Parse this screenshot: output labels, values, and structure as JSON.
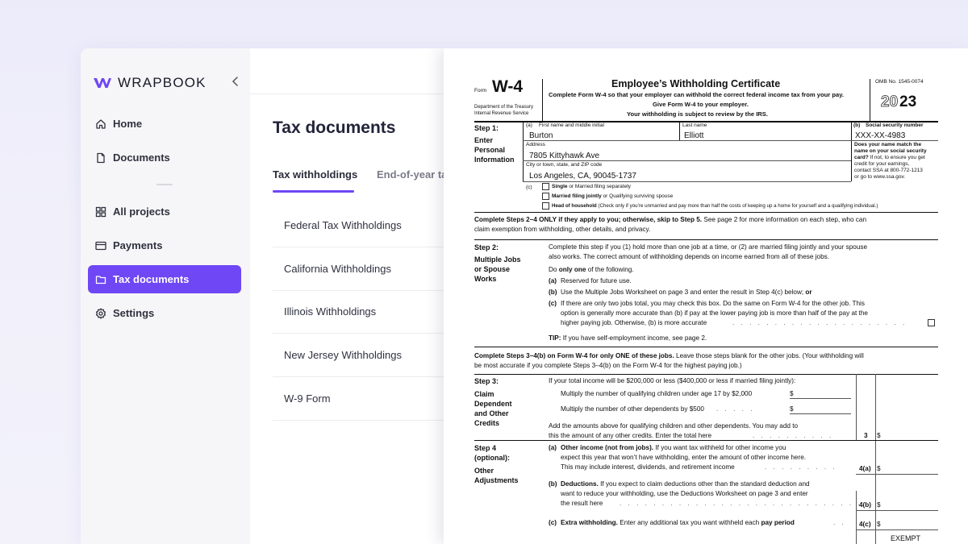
{
  "brand": {
    "name": "WRAPBOOK"
  },
  "colors": {
    "accent": "#6f47f5",
    "sidebar_bg": "#f6f6f8"
  },
  "sidebar": {
    "items": [
      {
        "label": "Home",
        "icon": "home-icon"
      },
      {
        "label": "Documents",
        "icon": "document-icon"
      },
      {
        "label": "All projects",
        "icon": "grid-icon"
      },
      {
        "label": "Payments",
        "icon": "card-icon"
      },
      {
        "label": "Tax documents",
        "icon": "folder-icon",
        "active": true
      },
      {
        "label": "Settings",
        "icon": "gear-icon"
      }
    ]
  },
  "main": {
    "title": "Tax documents",
    "tabs": [
      {
        "label": "Tax withholdings",
        "active": true
      },
      {
        "label": "End-of-year ta"
      }
    ],
    "list": [
      "Federal Tax Withholdings",
      "California Withholdings",
      "Illinois Withholdings",
      "New Jersey Withholdings",
      "W-9 Form"
    ]
  },
  "form": {
    "form_label": "Form",
    "form_name": "W-4",
    "dept": "Department of the Treasury",
    "irs": "Internal Revenue Service",
    "title": "Employee’s Withholding Certificate",
    "sub1": "Complete Form W-4 so that your employer can withhold the correct federal income tax from your pay.",
    "sub2": "Give Form W-4 to your employer.",
    "sub3": "Your withholding is subject to review by the IRS.",
    "omb": "OMB No. 1545-0074",
    "year_outline": "20",
    "year_bold": "23",
    "step1": {
      "label": "Step 1:",
      "l2": "Enter",
      "l3": "Personal",
      "l4": "Information"
    },
    "fields": {
      "a_label": "(a)",
      "first_label": "First name and middle initial",
      "first_value": "Burton",
      "last_label": "Last name",
      "last_value": "Elliott",
      "b_label": "(b)",
      "ssn_label": "Social security number",
      "ssn_value": "XXX-XX-4983",
      "address_label": "Address",
      "address_value": "7805 Kittyhawk Ave",
      "city_label": "City or town, state, and ZIP code",
      "city_value": "Los Angeles, CA, 90045-1737",
      "name_match": "Does your name match the",
      "name_match2": "name on your social security",
      "name_match3": "card?",
      "name_match3b": " If not, to ensure you get",
      "name_match4": "credit for your earnings,",
      "name_match5": "contact SSA at 800-772-1213",
      "name_match6": "or go to www.ssa.gov.",
      "c_label": "(c)",
      "single_b": "Single",
      "single_rest": " or Married filing separately",
      "married_b": "Married filing jointly",
      "married_rest": " or Qualifying surviving spouse",
      "hoh_b": "Head of household",
      "hoh_rest": " (Check only if you’re unmarried and pay more than half the costs of keeping up a home for yourself and a qualifying individual.)"
    },
    "notice_b": "Complete Steps 2–4 ONLY if they apply to you; otherwise, skip to Step 5.",
    "notice_rest": " See page 2 for more information on each step, who can",
    "notice2": "claim exemption from withholding, other details, and privacy.",
    "step2": {
      "label": "Step 2:",
      "l2": "Multiple Jobs",
      "l3": "or Spouse",
      "l4": "Works",
      "p1": "Complete this step if you (1) hold more than one job at a time, or (2) are married filing jointly and your spouse",
      "p2": "also works. The correct amount of withholding depends on income earned from all of these jobs.",
      "do_a": "Do ",
      "do_b": "only one",
      "do_c": " of the following.",
      "a_key": "(a)",
      "a_text": "Reserved for future use.",
      "b_key": "(b)",
      "b_text": "Use the Multiple Jobs Worksheet on page 3 and enter the result in Step 4(c) below; ",
      "b_or": "or",
      "c_key": "(c)",
      "c1": "If there are only two jobs total, you may check this box. Do the same on Form W-4 for the other job. This",
      "c2": "option is generally more accurate than (b) if pay at the lower paying job is more than half of the pay at the",
      "c3": "higher paying job. Otherwise, (b) is more accurate",
      "tip_b": "TIP:",
      "tip_rest": " If you have self-employment income, see page 2."
    },
    "notice3_b": "Complete Steps 3–4(b) on Form W-4 for only ONE of these jobs.",
    "notice3_rest": " Leave those steps blank for the other jobs. (Your withholding will",
    "notice3b": "be most accurate if you complete Steps 3–4(b) on the Form W-4 for the highest paying job.)",
    "step3": {
      "label": "Step 3:",
      "l2": "Claim",
      "l3": "Dependent",
      "l4": "and Other",
      "l5": "Credits",
      "p1": "If your total income will be $200,000 or less ($400,000 or less if married filing jointly):",
      "p2": "Multiply the number of qualifying children under age 17 by $2,000",
      "p3": "Multiply the number of other dependents by $500",
      "p4": "Add the amounts above for qualifying children and other dependents. You may add to",
      "p5": "this the amount of any other credits. Enter the total here",
      "line_no": "3",
      "dollar": "$"
    },
    "step4": {
      "label": "Step 4",
      "l2": "(optional):",
      "l3": "Other",
      "l4": "Adjustments",
      "a_key": "(a)",
      "a_b": "Other income (not from jobs).",
      "a1": " If you want tax withheld for other income you",
      "a2": "expect this year that won’t have withholding, enter the amount of other income here.",
      "a3": "This may include interest, dividends, and retirement income",
      "a_no": "4(a)",
      "b_key": "(b)",
      "b_b": "Deductions.",
      "b1": " If you expect to claim deductions other than the standard deduction and",
      "b2": "want to reduce your withholding, use the Deductions Worksheet on page 3 and enter",
      "b3": "the result here",
      "b_no": "4(b)",
      "c_key": "(c)",
      "c_b": "Extra withholding.",
      "c1": " Enter any additional tax you want withheld each ",
      "c_b2": "pay period",
      "c_no": "4(c)",
      "exempt": "EXEMPT"
    }
  }
}
